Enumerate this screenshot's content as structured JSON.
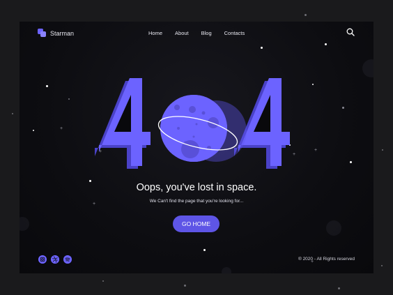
{
  "brand": {
    "name": "Starman",
    "logo_icon": "starman-logo-icon"
  },
  "nav": {
    "items": [
      {
        "label": "Home"
      },
      {
        "label": "About"
      },
      {
        "label": "Blog"
      },
      {
        "label": "Contacts"
      }
    ],
    "search_icon": "search-icon"
  },
  "hero": {
    "code": "404",
    "headline": "Oops, you've lost in space.",
    "subtext": "We Can't find the page that  you're looking for...",
    "button_label": "GO HOME"
  },
  "social": [
    {
      "icon": "instagram-icon"
    },
    {
      "icon": "dribbble-icon"
    },
    {
      "icon": "spotify-icon"
    }
  ],
  "footer": {
    "copyright": "® 2020 - All Rights reserved"
  },
  "colors": {
    "background": "#1a1a1c",
    "frame": "#0d0d11",
    "accent": "#6c63ff",
    "button": "#5e55e6",
    "digit": "#6c63ff",
    "digit_shade": "#4a42c8",
    "moon": "#6c63ff"
  }
}
